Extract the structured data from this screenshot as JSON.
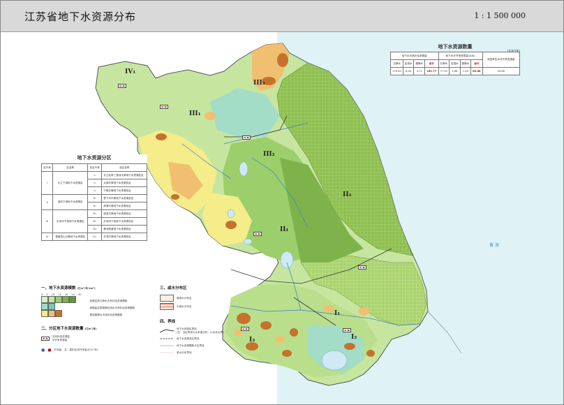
{
  "header": {
    "title": "江苏省地下水资源分布",
    "scale": "1 : 1 500 000"
  },
  "quantity_table": {
    "title": "地下水资源数量",
    "unit": "(亿m³/年)",
    "group_headers": [
      "地下水天然补给资源量",
      "地下水可开采资源量(淡水)",
      "深层承压水可开采资源量"
    ],
    "sub_headers": [
      "孔隙水",
      "岩溶水",
      "裂隙水",
      "合计",
      "孔隙水",
      "岩溶水",
      "裂隙水",
      "合计"
    ],
    "values": [
      "170.00",
      "8.05",
      "4.71",
      "182.77",
      "77.52",
      "1.66",
      "1.49",
      "80.68"
    ],
    "deep_value": "20.88",
    "highlight_color": "#cc0000"
  },
  "zone_table": {
    "title": "地下水资源分区",
    "headers": [
      "区代号",
      "区名称",
      "亚区代号",
      "亚区名称"
    ],
    "rows": [
      {
        "code": "I",
        "name": "长江下游地下水资源区",
        "sub": "I₁",
        "subname": "长江北岸三角洲平原地下水资源亚区"
      },
      {
        "code": "",
        "name": "",
        "sub": "I₂",
        "subname": "太湖平原地下水资源亚区"
      },
      {
        "code": "",
        "name": "",
        "sub": "I₃",
        "subname": "宁镇丘陵地下水资源亚区"
      },
      {
        "code": "II",
        "name": "淮河下游地下水资源区",
        "sub": "II₁",
        "subname": "里下河平原地下水资源亚区"
      },
      {
        "code": "",
        "name": "",
        "sub": "II₂",
        "subname": "滨海平原地下水资源亚区"
      },
      {
        "code": "III",
        "name": "沂沭河下游地下水资源区",
        "sub": "III₁",
        "subname": "徐淮平原地下水资源亚区"
      },
      {
        "code": "",
        "name": "",
        "sub": "III₂",
        "subname": "沂沭河下游地下水资源亚区"
      },
      {
        "code": "",
        "name": "",
        "sub": "III₃",
        "subname": "黄河故道地下水资源亚区"
      },
      {
        "code": "IV",
        "name": "鲁南低山丘陵地下水资源区",
        "sub": "IV₁",
        "subname": "丰沛平原地下水资源亚区"
      }
    ]
  },
  "legend1": {
    "title": "一、地下水资源模数",
    "unit": "(亿m³/年·km²)",
    "scale_labels": [
      "0",
      "5",
      "10",
      "15",
      "20",
      "25",
      "30"
    ],
    "items": [
      "松散岩类孔隙水天然补给资源模数",
      "碳酸盐岩类裂隙岩溶水天然补给资源模数",
      "基岩裂隙水天然补给资源模数"
    ]
  },
  "legend2": {
    "title": "二、分区地下水资源数量",
    "unit": "(亿m³/年)",
    "items": [
      "天然补给资源量",
      "可开采资源量"
    ],
    "dot_label": "开采量",
    "extra": "井、泉的实测开采量(亿m³/年)"
  },
  "legend3": {
    "title": "三、咸水分布区",
    "items": [
      "微咸水分布区",
      "半咸水分布区"
    ]
  },
  "legend4": {
    "title": "四、界线",
    "items": [
      "地下水资源区界线",
      "(注：当区界线与水系重合时，以水系为界)",
      "地下水资源亚区界线",
      "地下水资源模数分区界线",
      "咸水分布界线"
    ]
  },
  "map_labels": {
    "zones": [
      "IV₁",
      "III₁",
      "III₂",
      "III₃",
      "II₁",
      "II₂",
      "I₁",
      "I₂",
      "I₃"
    ],
    "sea": "黄  海"
  },
  "colors": {
    "header_bg": "#d9d9d9",
    "sea": "#dff3f6",
    "green_dark": "#7db34a",
    "green": "#9ccf6c",
    "green_light": "#c6e6a0",
    "green_pale": "#dcefc6",
    "yellow": "#f5ec8a",
    "orange": "#f0c070",
    "brown": "#c5722c",
    "coastal_grid": "#8ebf52",
    "teal": "#a3dcc7"
  }
}
